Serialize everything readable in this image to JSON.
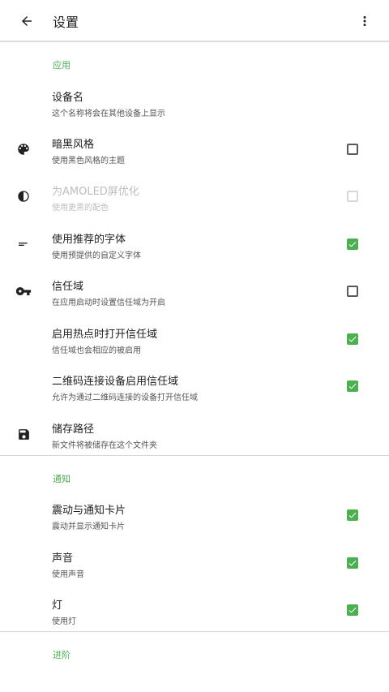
{
  "appbar": {
    "title": "设置",
    "back_icon": "arrow-back-icon",
    "menu_icon": "more-vert-icon"
  },
  "sections": {
    "app": {
      "header": "应用",
      "items": {
        "device_name": {
          "title": "设备名",
          "summary": "这个名称将会在其他设备上显示"
        },
        "dark_theme": {
          "title": "暗黑风格",
          "summary": "使用黑色风格的主题",
          "checked": false,
          "icon": "palette-icon"
        },
        "amoled": {
          "title": "为AMOLED屏优化",
          "summary": "使用更黑的配色",
          "checked": false,
          "enabled": false,
          "icon": "contrast-icon"
        },
        "font": {
          "title": "使用推荐的字体",
          "summary": "使用预提供的自定义字体",
          "checked": true,
          "icon": "short-text-icon"
        },
        "trust_zone": {
          "title": "信任域",
          "summary": "在应用启动时设置信任域为开启",
          "checked": false,
          "icon": "key-icon"
        },
        "hotspot_trust": {
          "title": "启用热点时打开信任域",
          "summary": "信任域也会相应的被启用",
          "checked": true
        },
        "qr_trust": {
          "title": "二维码连接设备启用信任域",
          "summary": "允许为通过二维码连接的设备打开信任域",
          "checked": true
        },
        "storage": {
          "title": "储存路径",
          "summary": "新文件将被储存在这个文件夹",
          "icon": "save-icon"
        }
      }
    },
    "notify": {
      "header": "通知",
      "items": {
        "vibrate": {
          "title": "震动与通知卡片",
          "summary": "震动并显示通知卡片",
          "checked": true
        },
        "sound": {
          "title": "声音",
          "summary": "使用声音",
          "checked": true
        },
        "light": {
          "title": "灯",
          "summary": "使用灯",
          "checked": true
        }
      }
    },
    "advanced": {
      "header": "进阶"
    }
  },
  "colors": {
    "accent": "#4caf50",
    "text_primary": "#212121",
    "text_secondary": "#555555",
    "disabled": "#bdbdbd"
  }
}
